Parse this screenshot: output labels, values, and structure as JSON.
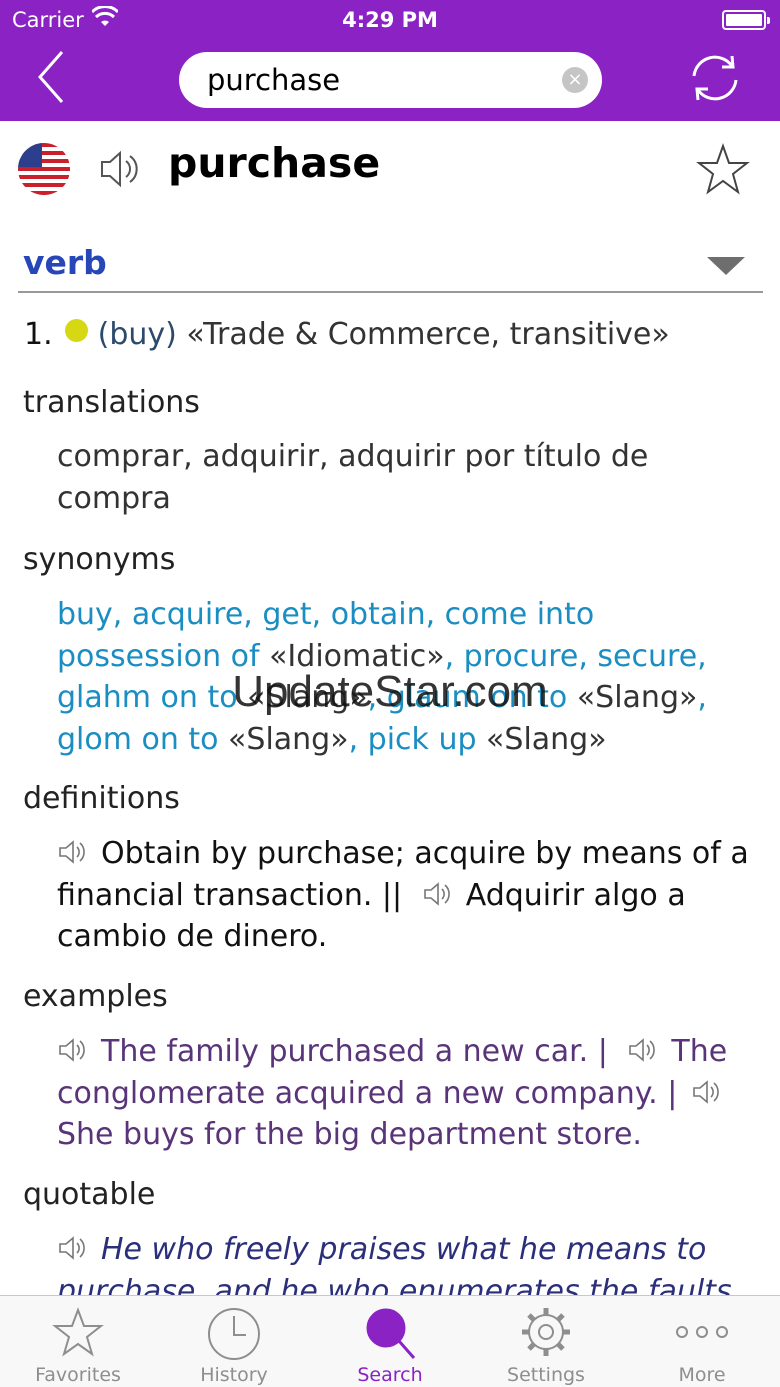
{
  "status_bar": {
    "carrier": "Carrier",
    "time": "4:29 PM"
  },
  "nav": {
    "search_value": "purchase",
    "clear_label": "×"
  },
  "entry": {
    "headword": "purchase",
    "part_of_speech": "verb",
    "sense_number": "1.",
    "sense_gloss": "(buy)",
    "sense_labels": "«Trade & Commerce, transitive»",
    "sections": {
      "translations": "translations",
      "synonyms": "synonyms",
      "definitions": "definitions",
      "examples": "examples",
      "quotable": "quotable"
    },
    "translations_text": "comprar, adquirir, adquirir por título de compra",
    "synonyms": {
      "s1": "buy, acquire, get, obtain, come into possession of",
      "tag1": " «Idiomatic»",
      "s2": ", procure, secure, glahm on to",
      "tag2": " «Slang»",
      "s3": ", glaum on to",
      "tag3": " «Slang»",
      "s4": ", glom on to",
      "tag4": " «Slang»",
      "s5": ", pick up",
      "tag5": " «Slang»"
    },
    "definitions": {
      "d1": "Obtain by purchase; acquire by means of a financial transaction. ||",
      "d2": "Adquirir algo a cambio de dinero."
    },
    "examples": {
      "e1": "The family purchased a new car. |",
      "e2": "The conglomerate acquired a new company. |",
      "e3": "She buys for the big department store."
    },
    "quote": "He who freely praises what he means to purchase, and he who enumerates the faults"
  },
  "watermark": "UpdateStar.com",
  "tabs": [
    {
      "label": "Favorites",
      "icon": "star-icon"
    },
    {
      "label": "History",
      "icon": "clock-icon"
    },
    {
      "label": "Search",
      "icon": "magnifier-icon"
    },
    {
      "label": "Settings",
      "icon": "gear-icon"
    },
    {
      "label": "More",
      "icon": "more-dots-icon"
    }
  ],
  "colors": {
    "accent": "#8a22c4",
    "pos": "#2747b8",
    "synonym_link": "#1a8ec2",
    "example_text": "#5a3478",
    "quote_text": "#2b2f7a",
    "sense_dot": "#d6d814"
  }
}
